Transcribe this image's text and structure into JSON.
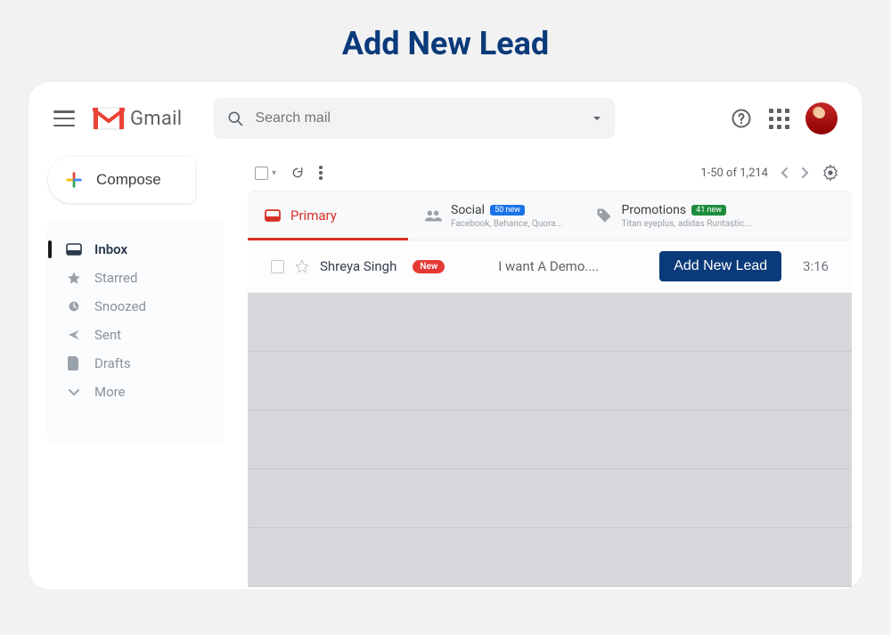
{
  "page_title": "Add New Lead",
  "brand": "Gmail",
  "search": {
    "placeholder": "Search mail"
  },
  "compose_label": "Compose",
  "sidebar": {
    "items": [
      {
        "label": "Inbox"
      },
      {
        "label": "Starred"
      },
      {
        "label": "Snoozed"
      },
      {
        "label": "Sent"
      },
      {
        "label": "Drafts"
      },
      {
        "label": "More"
      }
    ]
  },
  "toolbar": {
    "pagination": "1-50 of 1,214"
  },
  "tabs": {
    "primary": {
      "label": "Primary"
    },
    "social": {
      "label": "Social",
      "badge": "50 new",
      "sub": "Facebook, Behance, Quora..."
    },
    "promotions": {
      "label": "Promotions",
      "badge": "41 new",
      "sub": "Titan eyeplus, adidas Runtastic..."
    }
  },
  "email": {
    "sender": "Shreya Singh",
    "new_label": "New",
    "subject": "I want A Demo....",
    "cta": "Add New Lead",
    "time": "3:16"
  }
}
